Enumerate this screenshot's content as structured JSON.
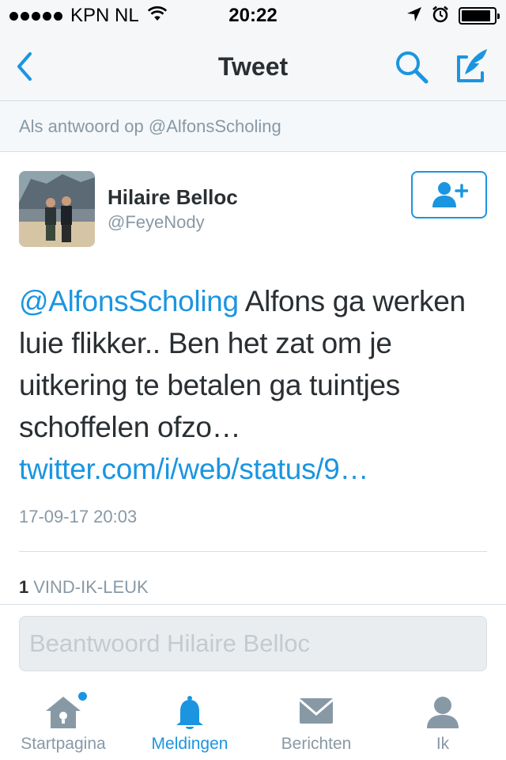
{
  "status_bar": {
    "carrier": "KPN NL",
    "time": "20:22",
    "battery_level": 0.9
  },
  "nav": {
    "title": "Tweet",
    "back_icon": "chevron-left-icon",
    "search_icon": "search-icon",
    "compose_icon": "compose-tweet-icon"
  },
  "reply_context": "Als antwoord op @AlfonsScholing",
  "tweet": {
    "author_name": "Hilaire Belloc",
    "author_handle": "@FeyeNody",
    "mention": "@AlfonsScholing",
    "body": " Alfons ga werken luie flikker.. Ben het zat om je uitkering te betalen ga tuintjes schoffelen ofzo… ",
    "link": "twitter.com/i/web/status/9…",
    "timestamp": "17-09-17 20:03",
    "like_count": "1",
    "like_label": "VIND-IK-LEUK"
  },
  "reply_box": {
    "placeholder": "Beantwoord Hilaire Belloc"
  },
  "tabs": [
    {
      "label": "Startpagina",
      "icon": "home-icon",
      "active": false,
      "has_dot": true
    },
    {
      "label": "Meldingen",
      "icon": "bell-icon",
      "active": true,
      "has_dot": false
    },
    {
      "label": "Berichten",
      "icon": "envelope-icon",
      "active": false,
      "has_dot": false
    },
    {
      "label": "Ik",
      "icon": "person-icon",
      "active": false,
      "has_dot": false
    }
  ],
  "colors": {
    "accent": "#1b95e0",
    "muted": "#8899a6",
    "text": "#292f33",
    "background_bar": "#f6f7f8"
  }
}
